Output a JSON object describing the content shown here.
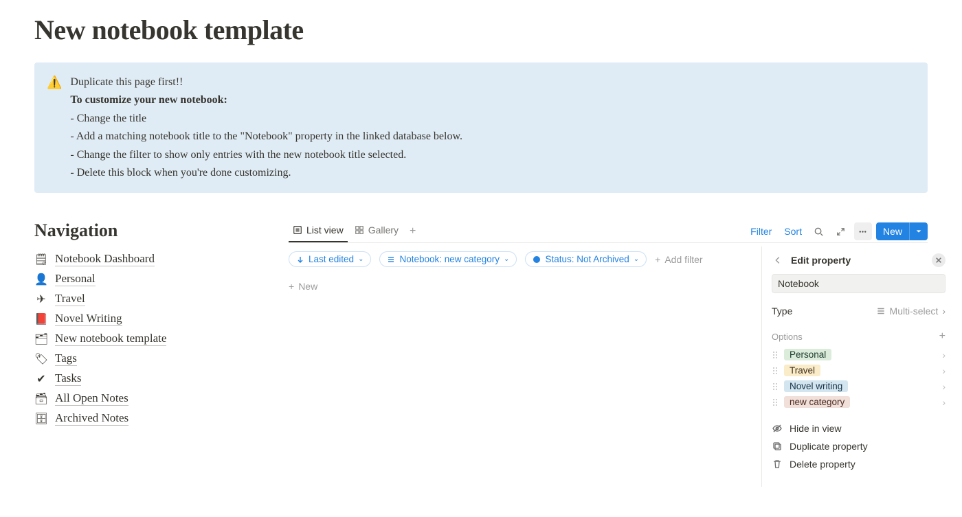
{
  "page": {
    "title": "New notebook template"
  },
  "callout": {
    "icon": "⚠️",
    "line1": "Duplicate this page first!!",
    "line2": "To customize your new notebook:",
    "bullets": [
      "- Change the title",
      "- Add a matching notebook title to the \"Notebook\" property in the linked database below.",
      "- Change the filter to show only entries with the new notebook title selected.",
      "- Delete this block when you're done customizing."
    ]
  },
  "nav": {
    "heading": "Navigation",
    "items": [
      {
        "icon": "notebook-dashboard-icon",
        "glyph": "🗒",
        "label": "Notebook Dashboard"
      },
      {
        "icon": "personal-icon",
        "glyph": "👤",
        "label": "Personal"
      },
      {
        "icon": "travel-icon",
        "glyph": "✈",
        "label": "Travel"
      },
      {
        "icon": "book-icon",
        "glyph": "📕",
        "label": "Novel Writing"
      },
      {
        "icon": "new-notebook-icon",
        "glyph": "🗂",
        "label": "New notebook template"
      },
      {
        "icon": "tag-icon",
        "glyph": "🏷",
        "label": "Tags"
      },
      {
        "icon": "tasks-icon",
        "glyph": "✔",
        "label": "Tasks"
      },
      {
        "icon": "open-notes-icon",
        "glyph": "🗃",
        "label": "All Open Notes"
      },
      {
        "icon": "archived-icon",
        "glyph": "🗄",
        "label": "Archived Notes"
      }
    ]
  },
  "db": {
    "tabs": [
      {
        "icon": "list-icon",
        "label": "List view",
        "active": true
      },
      {
        "icon": "gallery-icon",
        "label": "Gallery",
        "active": false
      }
    ],
    "controls": {
      "filter": "Filter",
      "sort": "Sort",
      "new": "New"
    },
    "filters": [
      {
        "icon": "sort-down-icon",
        "label": "Last edited"
      },
      {
        "icon": "multiselect-icon",
        "label": "Notebook: new category"
      },
      {
        "icon": "status-icon",
        "label": "Status: Not Archived"
      }
    ],
    "add_filter": "Add filter",
    "new_row": "New"
  },
  "panel": {
    "title": "Edit property",
    "name": "Notebook",
    "type_label": "Type",
    "type_value": "Multi-select",
    "options_label": "Options",
    "options": [
      {
        "label": "Personal",
        "bg": "#dbecdb",
        "fg": "#1c3829"
      },
      {
        "label": "Travel",
        "bg": "#faecc8",
        "fg": "#402c1b"
      },
      {
        "label": "Novel writing",
        "bg": "#d3e5ef",
        "fg": "#183347"
      },
      {
        "label": "new category",
        "bg": "#f1dfda",
        "fg": "#4c2c22"
      }
    ],
    "actions": {
      "hide": "Hide in view",
      "duplicate": "Duplicate property",
      "delete": "Delete property"
    }
  }
}
